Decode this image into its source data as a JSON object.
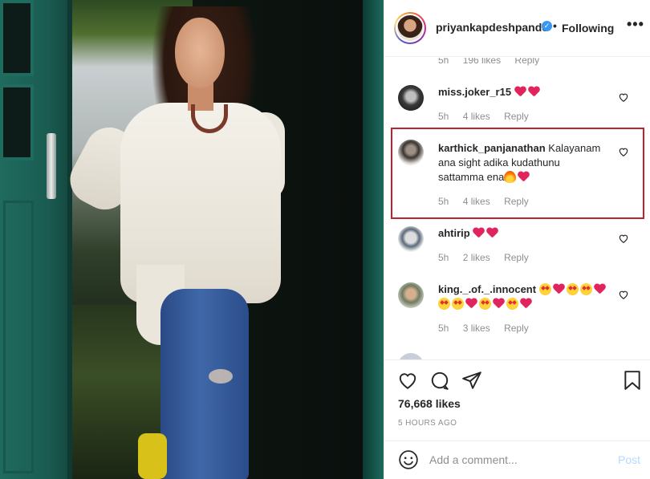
{
  "header": {
    "username": "priyankapdeshpande",
    "separator": "•",
    "follow_state": "Following",
    "more": "•••"
  },
  "comments": [
    {
      "username": "",
      "text": "",
      "time": "5h",
      "likes": "196 likes",
      "reply": "Reply"
    },
    {
      "username": "miss.joker_r15",
      "text": "",
      "emoji": [
        "heart",
        "heart"
      ],
      "time": "5h",
      "likes": "4 likes",
      "reply": "Reply"
    },
    {
      "username": "karthick_panjanathan",
      "text": "Kalayanam ana sight adika kudathunu sattamma ena",
      "emoji": [
        "fire",
        "heart"
      ],
      "time": "5h",
      "likes": "4 likes",
      "reply": "Reply",
      "highlighted": true
    },
    {
      "username": "ahtirip",
      "text": "",
      "emoji": [
        "heart",
        "heart"
      ],
      "time": "5h",
      "likes": "2 likes",
      "reply": "Reply"
    },
    {
      "username": "king._.of._.innocent",
      "text": "",
      "emoji": [
        "star",
        "heart",
        "star",
        "star",
        "heart",
        "star",
        "star",
        "heart",
        "star",
        "heart",
        "star",
        "heart"
      ],
      "time": "5h",
      "likes": "3 likes",
      "reply": "Reply"
    }
  ],
  "actions": {
    "icons": [
      "heart-icon",
      "comment-icon",
      "share-icon",
      "bookmark-icon"
    ],
    "likes": "76,668 likes",
    "time_ago": "5 HOURS AGO"
  },
  "add_comment": {
    "placeholder": "Add a comment...",
    "post_label": "Post"
  },
  "colors": {
    "verified": "#3897f0",
    "heart_red": "#e0245e",
    "post_disabled": "#b3dbff",
    "highlight_border": "#c21f2e"
  }
}
